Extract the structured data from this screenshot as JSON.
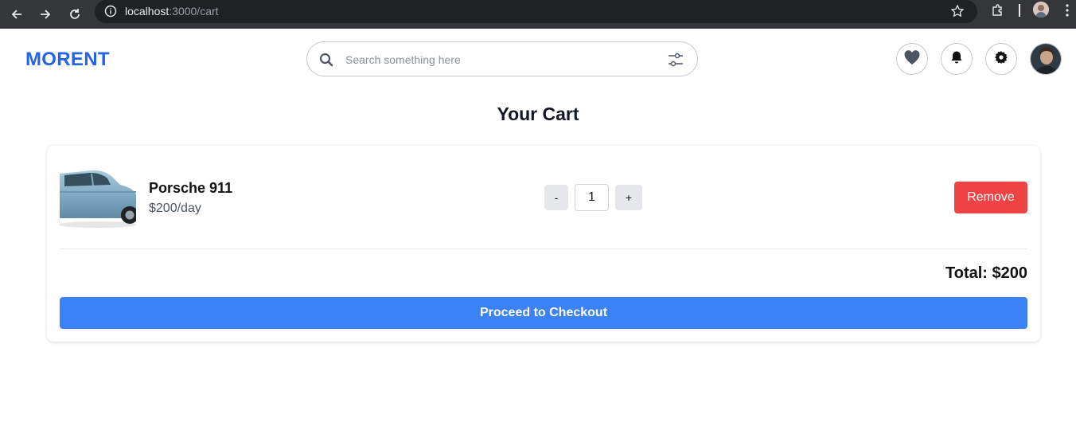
{
  "browser": {
    "url_host": "localhost",
    "url_path": ":3000/cart"
  },
  "header": {
    "logo": "MORENT",
    "search": {
      "placeholder": "Search something here"
    },
    "icons": [
      "heart-icon",
      "bell-icon",
      "gear-icon",
      "avatar"
    ]
  },
  "page": {
    "title": "Your Cart"
  },
  "cart": {
    "items": [
      {
        "name": "Porsche 911",
        "price": "$200/day",
        "quantity": "1",
        "remove_label": "Remove"
      }
    ],
    "decrement_label": "-",
    "increment_label": "+",
    "total": "Total: $200",
    "checkout_label": "Proceed to Checkout"
  },
  "colors": {
    "brand": "#2563eb",
    "checkout": "#3b82f6",
    "remove": "#ef4444"
  }
}
